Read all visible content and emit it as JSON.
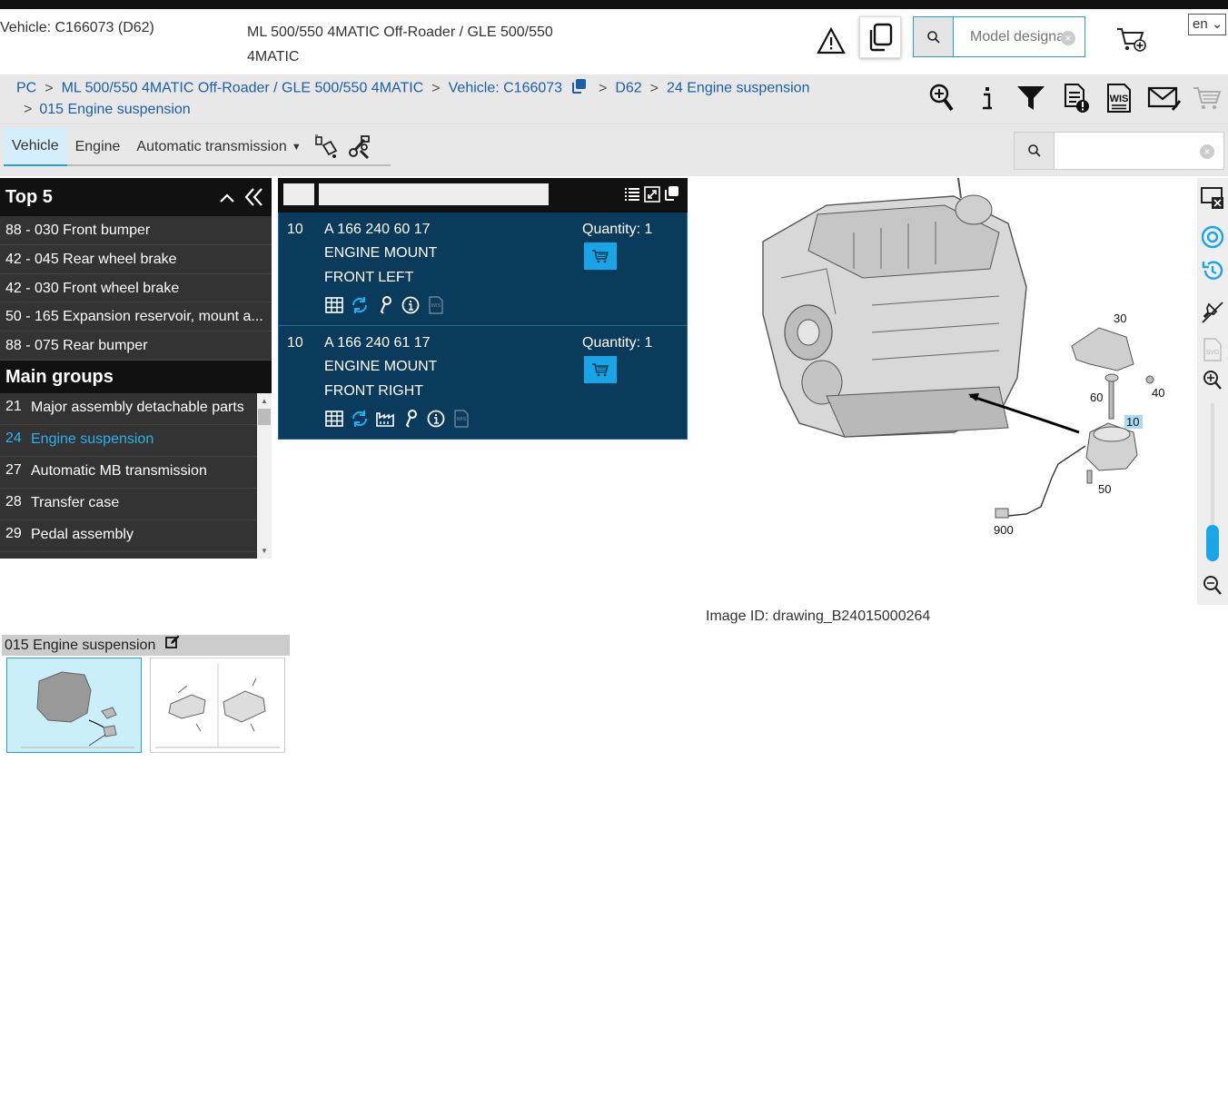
{
  "header": {
    "vehicle": "Vehicle: C166073 (D62)",
    "model": "ML 500/550 4MATIC Off-Roader / GLE 500/550 4MATIC",
    "search_placeholder": "Model designa",
    "language": "en"
  },
  "breadcrumb": {
    "items": [
      "PC",
      "ML 500/550 4MATIC Off-Roader / GLE 500/550 4MATIC",
      "Vehicle: C166073",
      "D62",
      "24 Engine suspension",
      "015 Engine suspension"
    ]
  },
  "tabs": [
    "Vehicle",
    "Engine",
    "Automatic transmission"
  ],
  "top5": {
    "title": "Top 5",
    "items": [
      "88 - 030 Front bumper",
      "42 - 045 Rear wheel brake",
      "42 - 030 Front wheel brake",
      "50 - 165 Expansion reservoir, mount a...",
      "88 - 075 Rear bumper"
    ]
  },
  "main_groups": {
    "title": "Main groups",
    "items": [
      {
        "num": "21",
        "label": "Major assembly detachable parts"
      },
      {
        "num": "24",
        "label": "Engine suspension"
      },
      {
        "num": "27",
        "label": "Automatic MB transmission"
      },
      {
        "num": "28",
        "label": "Transfer case"
      },
      {
        "num": "29",
        "label": "Pedal assembly"
      }
    ]
  },
  "parts": [
    {
      "pos": "10",
      "number": "A 166 240 60 17",
      "desc1": "ENGINE MOUNT",
      "desc2": "FRONT LEFT",
      "quantity": "Quantity: 1"
    },
    {
      "pos": "10",
      "number": "A 166 240 61 17",
      "desc1": "ENGINE MOUNT",
      "desc2": "FRONT RIGHT",
      "quantity": "Quantity: 1"
    }
  ],
  "drawing": {
    "callouts": [
      "30",
      "60",
      "40",
      "10",
      "50",
      "900"
    ],
    "image_id": "Image ID: drawing_B24015000264"
  },
  "thumbnails": {
    "title": "015 Engine suspension"
  },
  "colors": {
    "accent": "#2a9fd6",
    "part_bg": "#0a3b5c",
    "cart_btn": "#19a4e6",
    "dark_panel": "#333333"
  }
}
